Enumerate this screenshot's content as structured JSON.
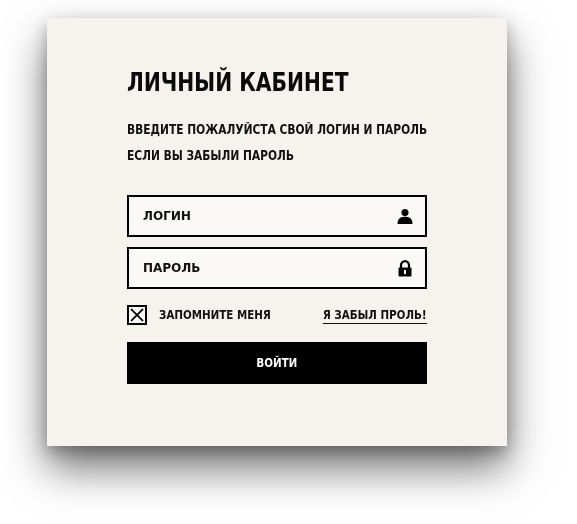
{
  "header": {
    "title": "ЛИЧНЫЙ КАБИНЕТ",
    "subtitle_line1": "ВВЕДИТЕ ПОЖАЛУЙСТА СВОЙ ЛОГИН И ПАРОЛЬ",
    "subtitle_line2": "ЕСЛИ ВЫ ЗАБЫЛИ ПАРОЛЬ"
  },
  "form": {
    "login_placeholder": "ЛОГИН",
    "login_value": "",
    "login_icon": "user-icon",
    "password_placeholder": "ПАРОЛЬ",
    "password_value": "",
    "password_icon": "lock-icon",
    "remember_label": "ЗАПОМНИТЕ МЕНЯ",
    "remember_checked": true,
    "forgot_link": "Я ЗАБЫЛ ПРОЛЬ!",
    "submit_label": "ВОЙТИ"
  },
  "colors": {
    "card_background": "#f6f3ef",
    "button_background": "#000000",
    "button_text": "#ffffff",
    "text": "#111111"
  }
}
